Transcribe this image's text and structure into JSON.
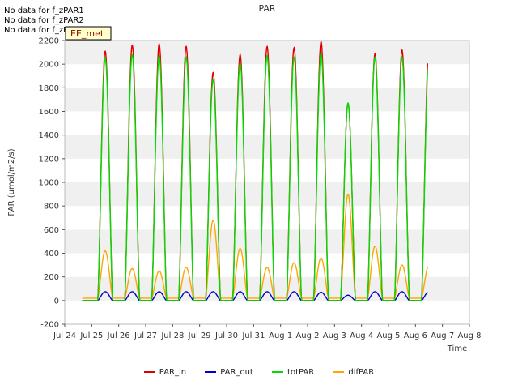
{
  "notes": [
    "No data for f_zPAR1",
    "No data for f_zPAR2",
    "No data for f_zPAR3"
  ],
  "badge": "EE_met",
  "chart_data": {
    "type": "line",
    "title": "PAR",
    "xlabel": "Time",
    "ylabel": "PAR (umol/m2/s)",
    "ylim": [
      -200,
      2200
    ],
    "yticks": [
      -200,
      0,
      200,
      400,
      600,
      800,
      1000,
      1200,
      1400,
      1600,
      1800,
      2000,
      2200
    ],
    "xlim": [
      0,
      15
    ],
    "x_tick_labels": [
      "Jul 24",
      "Jul 25",
      "Jul 26",
      "Jul 27",
      "Jul 28",
      "Jul 29",
      "Jul 30",
      "Jul 31",
      "Aug 1",
      "Aug 2",
      "Aug 3",
      "Aug 4",
      "Aug 5",
      "Aug 6",
      "Aug 7",
      "Aug 8"
    ],
    "grid": "horizontal bands",
    "legend_position": "bottom-center",
    "daily_peaks": {
      "PAR_in": [
        2110,
        2160,
        2170,
        2150,
        1930,
        2080,
        2150,
        2140,
        2190,
        1670,
        2090,
        2120,
        2130,
        2110
      ],
      "PAR_out": [
        75,
        75,
        75,
        75,
        75,
        75,
        75,
        75,
        70,
        45,
        75,
        75,
        75,
        75
      ],
      "totPAR": [
        2050,
        2080,
        2070,
        2060,
        1870,
        2010,
        2070,
        2060,
        2090,
        1670,
        2060,
        2060,
        2060,
        2050
      ],
      "difPAR": [
        420,
        270,
        250,
        280,
        680,
        440,
        280,
        320,
        360,
        900,
        460,
        300,
        300,
        320
      ]
    },
    "series": [
      {
        "name": "PAR_in",
        "color": "#dd0000"
      },
      {
        "name": "PAR_out",
        "color": "#0000cc"
      },
      {
        "name": "totPAR",
        "color": "#00dd00"
      },
      {
        "name": "difPAR",
        "color": "#ffa500"
      }
    ]
  }
}
